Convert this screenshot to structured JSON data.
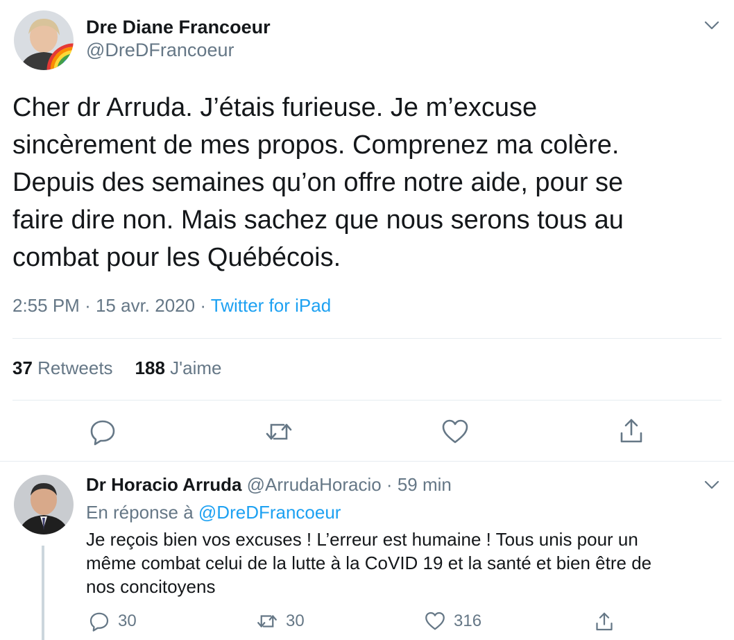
{
  "main_tweet": {
    "author_name": "Dre Diane Francoeur",
    "author_handle": "@DreDFrancoeur",
    "text_lines": [
      "Cher dr Arruda.  J’étais furieuse.  Je m’excuse",
      "sincèrement de mes propos. Comprenez ma colère.",
      "Depuis des semaines qu’on offre notre aide, pour se",
      "faire dire non. Mais sachez que nous serons tous au",
      "combat pour les Québécois."
    ],
    "time": "2:55 PM",
    "separator": "·",
    "date": "15 avr. 2020",
    "source": "Twitter for iPad",
    "retweets_count": "37",
    "retweets_label": "Retweets",
    "likes_count": "188",
    "likes_label": "J'aime"
  },
  "reply": {
    "author_name": "Dr Horacio Arruda",
    "author_handle": "@ArrudaHoracio",
    "separator": "·",
    "time_ago": "59 min",
    "reply_prefix": "En réponse à",
    "reply_mention": "@DreDFrancoeur",
    "text_lines": [
      "Je reçois bien vos excuses ! L’erreur est humaine ! Tous unis pour un",
      "même combat  celui de la lutte à la CoVID 19 et la santé et bien être de",
      "nos concitoyens"
    ],
    "reply_count": "30",
    "retweet_count": "30",
    "like_count": "316"
  },
  "icons": {
    "reply": "reply-icon",
    "retweet": "retweet-icon",
    "like": "heart-icon",
    "share": "share-icon",
    "more": "chevron-down-icon"
  },
  "colors": {
    "text": "#14171a",
    "secondary": "#657786",
    "link": "#1da1f2",
    "divider": "#e6ecf0"
  }
}
